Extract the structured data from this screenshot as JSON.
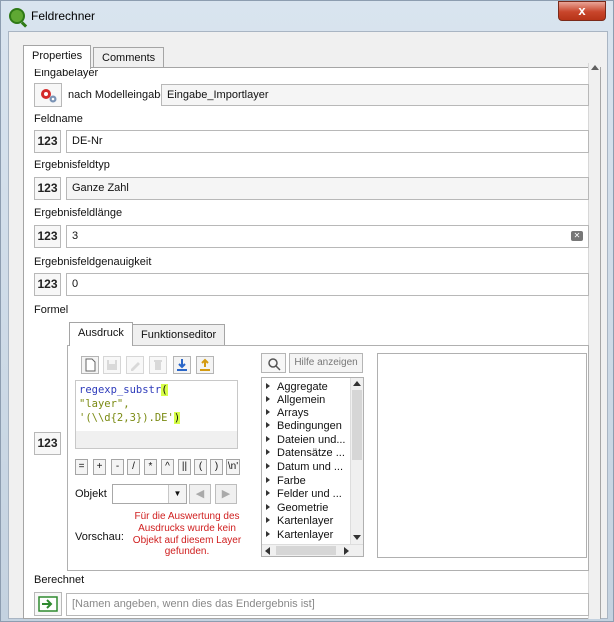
{
  "window": {
    "title": "Feldrechner",
    "close_glyph": "x"
  },
  "tabs": [
    {
      "label": "Properties"
    },
    {
      "label": "Comments"
    }
  ],
  "eingabelayer": {
    "label": "Eingabelayer",
    "source": "nach Modelleingabe",
    "value": "Eingabe_Importlayer"
  },
  "feldname": {
    "label": "Feldname",
    "value": "DE-Nr"
  },
  "ergebnisfeldtyp": {
    "label": "Ergebnisfeldtyp",
    "value": "Ganze Zahl"
  },
  "ergebnisfeldlaenge": {
    "label": "Ergebnisfeldlänge",
    "value": "3"
  },
  "ergebnisfeldgenauigkeit": {
    "label": "Ergebnisfeldgenauigkeit",
    "value": "0"
  },
  "number_icon": "123",
  "formel": {
    "label": "Formel",
    "tabs": [
      {
        "label": "Ausdruck"
      },
      {
        "label": "Funktionseditor"
      }
    ],
    "expression": {
      "line1_fn": "regexp_substr",
      "line1_paren": "(",
      "line2": "\"layer\",",
      "line3_str": "'(\\\\d{2,3}).DE'",
      "line3_paren": ")"
    },
    "operators": [
      "=",
      "+",
      "-",
      "/",
      "*",
      "^",
      "||",
      "(",
      ")",
      "\\n'"
    ],
    "objekt_label": "Objekt",
    "vorschau_label": "Vorschau:",
    "vorschau_text": "Für die Auswertung des Ausdrucks wurde kein Objekt auf diesem Layer gefunden.",
    "search_placeholder": "",
    "help_button": "Hilfe anzeigen",
    "function_groups": [
      "Aggregate",
      "Allgemein",
      "Arrays",
      "Bedingungen",
      "Dateien und...",
      "Datensätze ...",
      "Datum und ...",
      "Farbe",
      "Felder und ...",
      "Geometrie",
      "Kartenlayer",
      "Kartenlayer"
    ]
  },
  "berechnet": {
    "label": "Berechnet",
    "placeholder": "[Namen angeben, wenn dies das Endergebnis ist]"
  }
}
